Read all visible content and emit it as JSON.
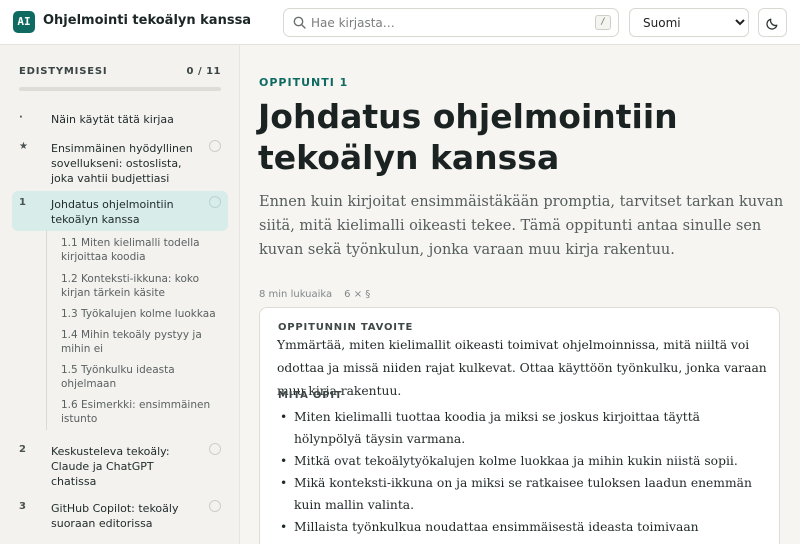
{
  "header": {
    "logo_text": "AI",
    "title": "Ohjelmointi tekoälyn kanssa",
    "search_placeholder": "Hae kirjasta…",
    "search_shortcut": "/",
    "language": "Suomi",
    "icons": [
      "search-icon",
      "chevron-down-icon",
      "moon-icon"
    ]
  },
  "sidebar": {
    "progress_label": "EDISTYMISESI",
    "progress_count": "0 / 11",
    "progress_fraction": 0,
    "items": [
      {
        "num": "·",
        "label": "Näin käytät tätä kirjaa"
      },
      {
        "num": "★",
        "label": "Ensimmäinen hyödyllinen sovellukseni: ostoslista, joka vahtii budjettiasi"
      },
      {
        "num": "1",
        "label": "Johdatus ohjelmointiin tekoälyn kanssa"
      },
      {
        "num": "2",
        "label": "Keskusteleva tekoäly: Claude ja ChatGPT chatissa"
      },
      {
        "num": "3",
        "label": "GitHub Copilot: tekoäly suoraan editorissa"
      }
    ],
    "subitems": [
      "1.1  Miten kielimalli todella kirjoittaa koodia",
      "1.2  Konteksti-ikkuna: koko kirjan tärkein käsite",
      "1.3  Työkalujen kolme luokkaa",
      "1.4  Mihin tekoäly pystyy ja mihin ei",
      "1.5  Työnkulku ideasta ohjelmaan",
      "1.6  Esimerkki: ensimmäinen istunto"
    ]
  },
  "main": {
    "eyebrow": "OPPITUNTI 1",
    "title": "Johdatus ohjelmointiin tekoälyn kanssa",
    "lede": "Ennen kuin kirjoitat ensimmäistäkään promptia, tarvitset tarkan kuvan siitä, mitä kielimalli oikeasti tekee. Tämä oppitunti antaa sinulle sen kuvan sekä työnkulun, jonka varaan muu kirja rakentuu.",
    "read_time": "8 min lukuaika",
    "sections": "6 × §",
    "goal_heading": "OPPITUNNIN TAVOITE",
    "goal_text": "Ymmärtää, miten kielimallit oikeasti toimivat ohjelmoinnissa, mitä niiltä voi odottaa ja missä niiden rajat kulkevat. Ottaa käyttöön työnkulku, jonka varaan muu kirja rakentuu.",
    "learn_heading": "MITÄ OPIT",
    "learn_items": [
      "Miten kielimalli tuottaa koodia ja miksi se joskus kirjoittaa täyttä hölynpölyä täysin varmana.",
      "Mitkä ovat tekoälytyökalujen kolme luokkaa ja mihin kukin niistä sopii.",
      "Mikä konteksti-ikkuna on ja miksi se ratkaisee tuloksen laadun enemmän kuin mallin valinta.",
      "Millaista työnkulkua noudattaa ensimmäisestä ideasta toimivaan ohjelmaan."
    ]
  }
}
